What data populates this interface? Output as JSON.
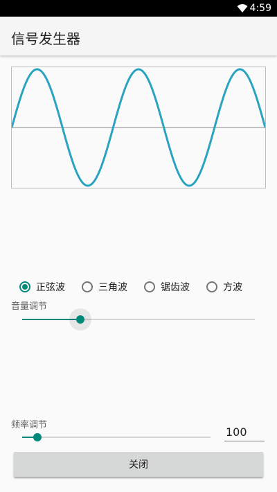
{
  "status_bar": {
    "time": "4:59",
    "wifi_icon": "wifi-icon"
  },
  "app_bar": {
    "title": "信号发生器"
  },
  "waveform": {
    "type": "sine",
    "cycles": 2.5,
    "wave_color": "#2aa3c1",
    "axis_color": "#b0b0b0"
  },
  "wave_type_options": [
    {
      "label": "正弦波",
      "checked": true
    },
    {
      "label": "三角波",
      "checked": false
    },
    {
      "label": "锯齿波",
      "checked": false
    },
    {
      "label": "方波",
      "checked": false
    }
  ],
  "volume": {
    "label": "音量调节",
    "value_fraction": 0.25
  },
  "frequency": {
    "label": "频率调节",
    "value_fraction": 0.08,
    "input_value": "100"
  },
  "close_button": {
    "label": "关闭"
  },
  "colors": {
    "accent": "#00897b",
    "app_bar_bg": "#f5f5f5",
    "button_bg": "#d6d7d7"
  }
}
